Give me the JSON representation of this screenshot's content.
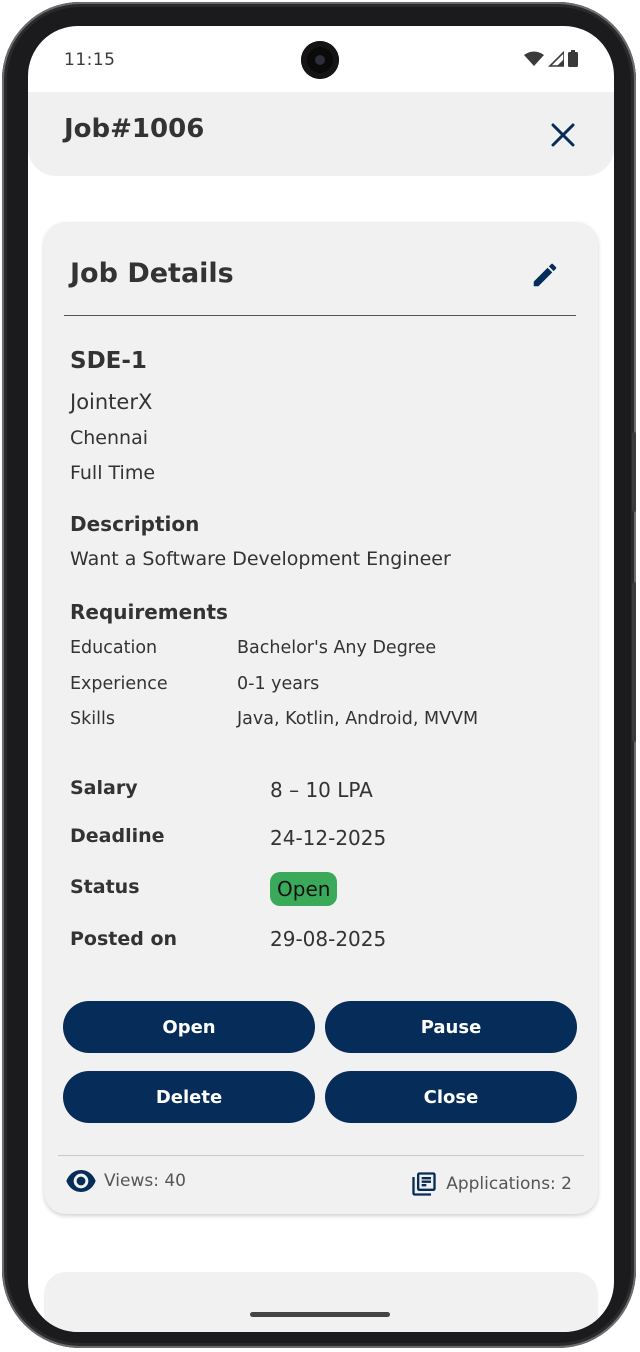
{
  "status_bar": {
    "time": "11:15"
  },
  "app_bar": {
    "title": "Job#1006"
  },
  "card": {
    "title": "Job Details",
    "job_title": "SDE-1",
    "company": "JointerX",
    "location": "Chennai",
    "job_type": "Full Time",
    "description_heading": "Description",
    "description": "Want a Software Development Engineer",
    "requirements_heading": "Requirements",
    "requirements": [
      {
        "label": "Education",
        "value": "Bachelor's Any Degree"
      },
      {
        "label": "Experience",
        "value": "0-1 years"
      },
      {
        "label": "Skills",
        "value": "Java, Kotlin, Android, MVVM"
      }
    ],
    "salary_label": "Salary",
    "salary": "8 – 10 LPA",
    "deadline_label": "Deadline",
    "deadline": "24-12-2025",
    "status_label": "Status",
    "status": "Open",
    "posted_label": "Posted on",
    "posted_on": "29-08-2025",
    "buttons": {
      "open": "Open",
      "pause": "Pause",
      "delete": "Delete",
      "close": "Close"
    },
    "footer": {
      "views": "Views: 40",
      "applications": "Applications: 2"
    }
  },
  "colors": {
    "primary": "#062c59",
    "status_open": "#3aaa5a",
    "card_bg": "#f1f1f1"
  },
  "icons": [
    "close-icon",
    "edit-icon",
    "eye-icon",
    "list-icon",
    "wifi-icon",
    "signal-icon",
    "battery-icon"
  ]
}
